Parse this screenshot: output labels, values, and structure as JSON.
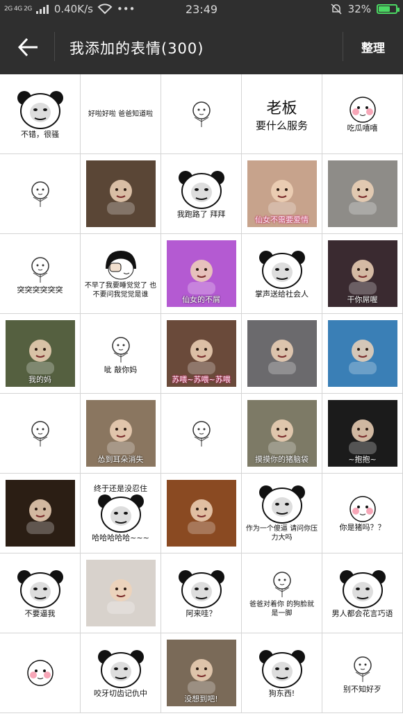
{
  "status": {
    "sim_labels": "2G 4G 2G",
    "speed": "0.40K/s",
    "dots": "•••",
    "time": "23:49",
    "battery": "32%"
  },
  "toolbar": {
    "title": "我添加的表情(300)",
    "action": "整理"
  },
  "colors": {
    "bar": "#2f2f2f",
    "battery": "#4cd964"
  },
  "stickers": [
    {
      "kind": "panda",
      "cap": "不错，很骚"
    },
    {
      "kind": "text",
      "cap": "好啦好啦 爸爸知道啦"
    },
    {
      "kind": "sketch",
      "cap": ""
    },
    {
      "kind": "bigtext",
      "cap": "老板",
      "cap2": "要什么服务"
    },
    {
      "kind": "blush",
      "cap": "吃瓜嘻嘻"
    },
    {
      "kind": "sketch",
      "cap": ""
    },
    {
      "kind": "photo",
      "bg": "#5a4636",
      "cap": ""
    },
    {
      "kind": "panda",
      "cap": "我跑路了 拜拜"
    },
    {
      "kind": "photo",
      "bg": "#c7a38c",
      "cap": "仙女不需要爱情",
      "capstyle": "pink"
    },
    {
      "kind": "photo",
      "bg": "#8e8c88",
      "cap": ""
    },
    {
      "kind": "sketch",
      "cap": "突突突突突突"
    },
    {
      "kind": "cartoon",
      "cap": "不早了我要睡觉觉了 也不要问我觉觉是谁"
    },
    {
      "kind": "photo",
      "bg": "#b45ad2",
      "cap": "仙女的不屑",
      "capstyle": "white"
    },
    {
      "kind": "panda",
      "cap": "掌声送给社会人"
    },
    {
      "kind": "photo",
      "bg": "#3a2a30",
      "cap": "干你屌喔",
      "capstyle": "white"
    },
    {
      "kind": "photo",
      "bg": "#556040",
      "cap": "我的妈",
      "capstyle": "white"
    },
    {
      "kind": "tiny",
      "cap": "呲 敲你妈"
    },
    {
      "kind": "photo",
      "bg": "#6a4a3a",
      "cap": "苏喂~苏喂~苏喂",
      "capstyle": "pink"
    },
    {
      "kind": "photo",
      "bg": "#6b6a6d",
      "cap": ""
    },
    {
      "kind": "photo",
      "bg": "#3a7fb6",
      "cap": ""
    },
    {
      "kind": "sketch",
      "cap": ""
    },
    {
      "kind": "photo",
      "bg": "#8a7660",
      "cap": "怂到耳朵消失",
      "capstyle": "white"
    },
    {
      "kind": "sketch",
      "cap": ""
    },
    {
      "kind": "photo",
      "bg": "#7d7a66",
      "cap": "摸摸你的猪脑袋",
      "capstyle": "white"
    },
    {
      "kind": "photo",
      "bg": "#1b1b1b",
      "cap": "~抱抱~",
      "capstyle": "white"
    },
    {
      "kind": "photo",
      "bg": "#2b1e14",
      "cap": ""
    },
    {
      "kind": "panda",
      "cap": "哈哈哈哈哈~~~",
      "cap0": "终于还是没忍住"
    },
    {
      "kind": "photo",
      "bg": "#8a4a22",
      "cap": ""
    },
    {
      "kind": "panda",
      "cap": "作为一个傻逼 请问你压力大吗"
    },
    {
      "kind": "blush",
      "cap": "你是猪吗？？"
    },
    {
      "kind": "panda",
      "cap": "不要逼我"
    },
    {
      "kind": "photo",
      "bg": "#d8d2cc",
      "cap": ""
    },
    {
      "kind": "panda",
      "cap": "阿来哇？"
    },
    {
      "kind": "sketch",
      "cap": "爸爸对着你 的狗脸就是一脚"
    },
    {
      "kind": "panda",
      "cap": "男人都会花言巧语"
    },
    {
      "kind": "blush",
      "cap": ""
    },
    {
      "kind": "panda",
      "cap": "咬牙切齿记仇中"
    },
    {
      "kind": "photo",
      "bg": "#7a6a58",
      "cap": "没想到吧!",
      "capstyle": "white"
    },
    {
      "kind": "panda",
      "cap": "狗东西!"
    },
    {
      "kind": "sketch",
      "cap": "别不知好歹"
    }
  ]
}
